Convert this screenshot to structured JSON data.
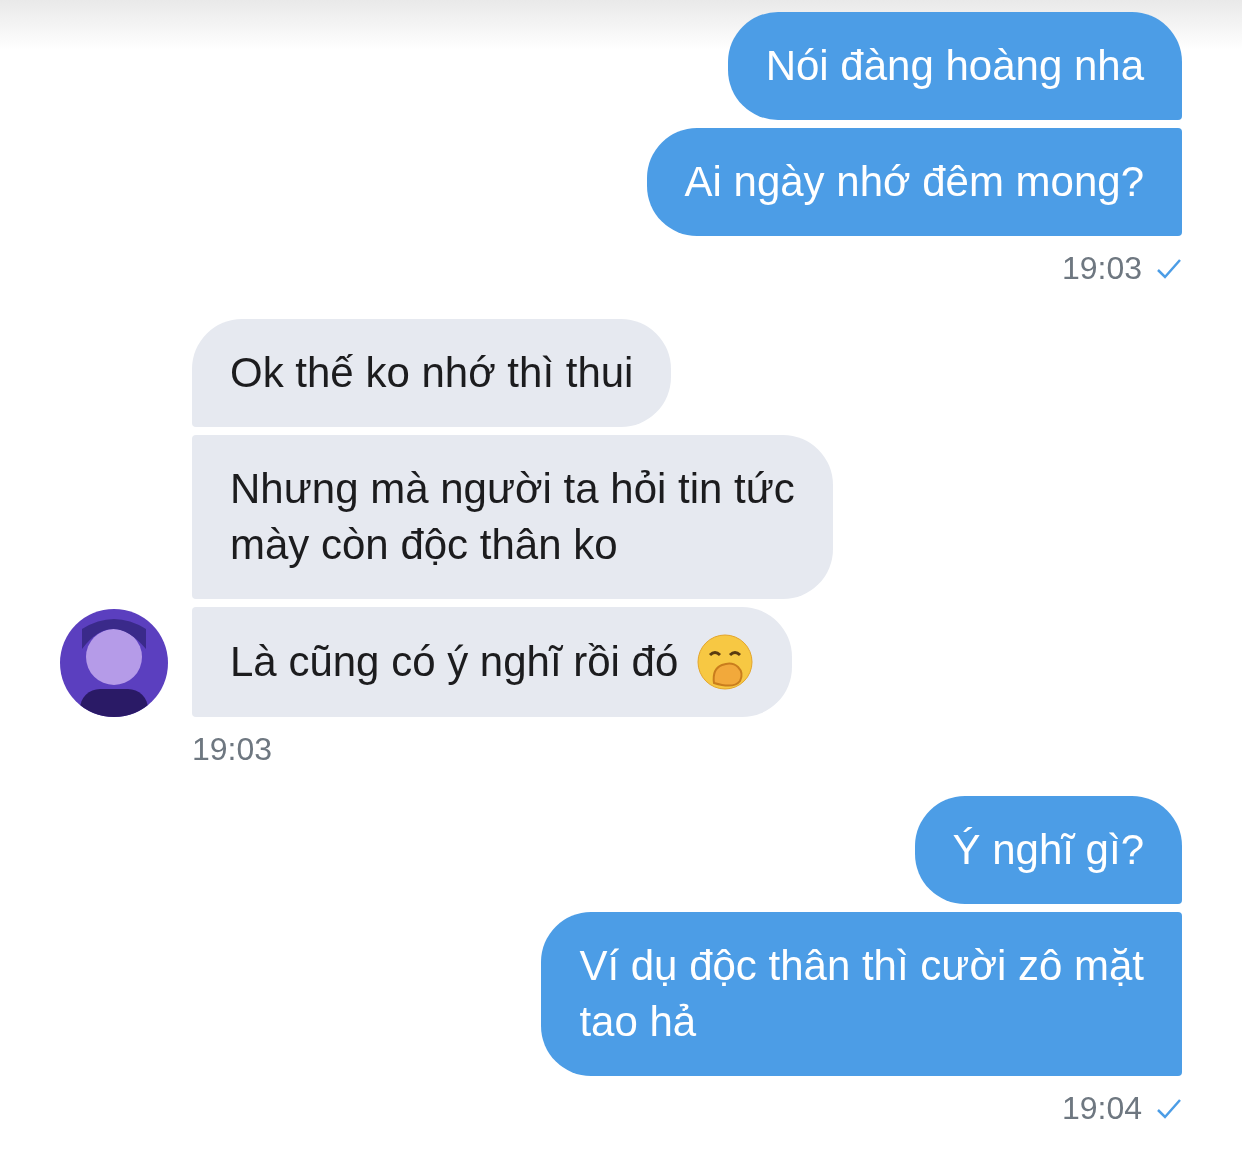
{
  "groups": [
    {
      "kind": "sent",
      "time": "19:03",
      "read": true,
      "messages": [
        {
          "text": "Nói đàng hoàng nha",
          "emoji": false
        },
        {
          "text": "Ai ngày nhớ đêm mong?",
          "emoji": false
        }
      ]
    },
    {
      "kind": "received",
      "time": "19:03",
      "read": false,
      "messages": [
        {
          "text": "Ok thế ko nhớ thì thui",
          "emoji": false
        },
        {
          "text": "Nhưng mà người ta hỏi tin tức\nmày còn độc thân ko",
          "emoji": false
        },
        {
          "text": "Là cũng có ý nghĩ rồi đó",
          "emoji": true
        }
      ]
    },
    {
      "kind": "sent",
      "time": "19:04",
      "read": true,
      "messages": [
        {
          "text": "Ý nghĩ gì?",
          "emoji": false
        },
        {
          "text": "Ví dụ độc thân thì cười zô mặt\ntao hả",
          "emoji": false
        }
      ]
    }
  ]
}
